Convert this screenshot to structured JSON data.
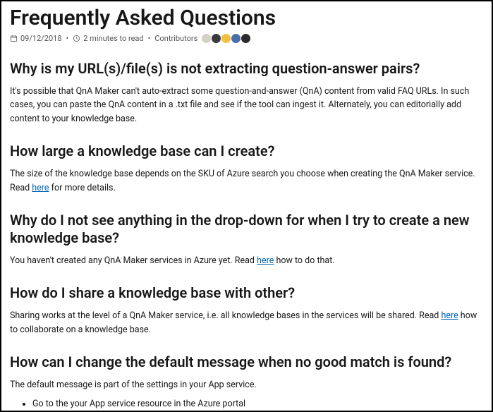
{
  "page": {
    "title": "Frequently Asked Questions"
  },
  "meta": {
    "date": "09/12/2018",
    "readtime": "2 minutes to read",
    "contributors_label": "Contributors",
    "contributors": [
      {
        "bg": "#d4d0c8"
      },
      {
        "bg": "#3a3a3a"
      },
      {
        "bg": "#f0c040"
      },
      {
        "bg": "#4a6ea9"
      },
      {
        "bg": "#2b2b2b"
      }
    ]
  },
  "faq": [
    {
      "question": "Why is my URL(s)/file(s) is not extracting question-answer pairs?",
      "answer_plain": "It's possible that QnA Maker can't auto-extract some question-and-answer (QnA) content from valid FAQ URLs. In such cases, you can paste the QnA content in a .txt file and see if the tool can ingest it. Alternately, you can editorially add content to your knowledge base."
    },
    {
      "question": "How large a knowledge base can I create?",
      "answer_pre": "The size of the knowledge base depends on the SKU of Azure search you choose when creating the QnA Maker service. Read ",
      "link_text": "here",
      "answer_post": " for more details."
    },
    {
      "question": "Why do I not see anything in the drop-down for when I try to create a new knowledge base?",
      "answer_pre": "You haven't created any QnA Maker services in Azure yet. Read ",
      "link_text": "here",
      "answer_post": " how to do that."
    },
    {
      "question": "How do I share a knowledge base with other?",
      "answer_pre": "Sharing works at the level of a QnA Maker service, i.e. all knowledge bases in the services will be shared. Read ",
      "link_text": "here",
      "answer_post": " how to collaborate on a knowledge base."
    },
    {
      "question": "How can I change the default message when no good match is found?",
      "answer_plain": "The default message is part of the settings in your App service.",
      "list": [
        "Go to the your App service resource in the Azure portal"
      ]
    }
  ]
}
